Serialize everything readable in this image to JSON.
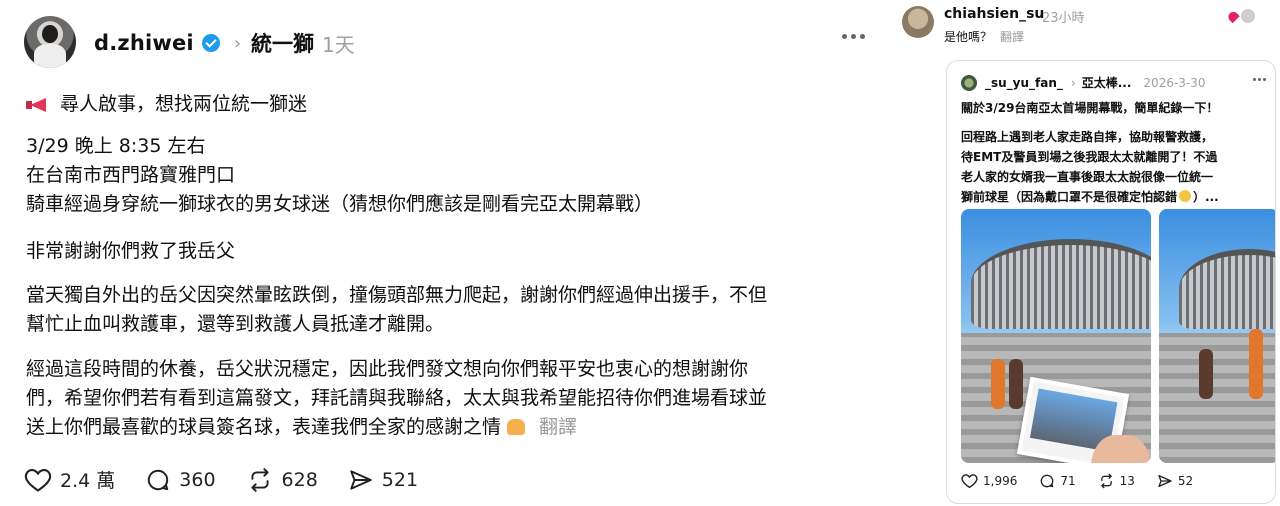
{
  "post": {
    "username": "d.zhiwei",
    "topic": "統一獅",
    "time": "1天",
    "lines": {
      "headline": "尋人啟事，想找兩位統一獅迷",
      "l1": "3/29 晚上 8:35 左右",
      "l2": "在台南市西門路寶雅門口",
      "l3": "騎車經過身穿統一獅球衣的男女球迷（猜想你們應該是剛看完亞太開幕戰）",
      "l4": "非常謝謝你們救了我岳父",
      "l5a": "當天獨自外出的岳父因突然暈眩跌倒，撞傷頭部無力爬起，謝謝你們經過伸出援手，不但",
      "l5b": "幫忙止血叫救護車，還等到救護人員抵達才離開。",
      "l6a": "經過這段時間的休養，岳父狀況穩定，因此我們發文想向你們報平安也衷心的想謝謝你",
      "l6b": "們，希望你們若有看到這篇發文，拜託請與我聯絡，太太與我希望能招待你們進場看球並",
      "l6c": "送上你們最喜歡的球員簽名球，表達我們全家的感謝之情"
    },
    "translate": "翻譯",
    "stats": {
      "likes": "2.4 萬",
      "comments": "360",
      "reposts": "628",
      "shares": "521"
    }
  },
  "reply": {
    "username": "chiahsien_su",
    "time": "23小時",
    "text": "是他嗎？",
    "translate": "翻譯",
    "quoted": {
      "username": "_su_yu_fan_",
      "topic": "亞太棒...",
      "date": "2026-3-30",
      "title": "關於3/29台南亞太首場開幕戰，簡單紀錄一下！",
      "b1": "回程路上遇到老人家走路自摔，協助報警救護，",
      "b2": "待EMT及警員到場之後我跟太太就離開了！不過",
      "b3": "老人家的女婿我一直事後跟太太說很像一位統一",
      "b4a": "獅前球星（因為戴口罩不是很確定怕認錯",
      "b4b": "）...",
      "stats": {
        "likes": "1,996",
        "comments": "71",
        "reposts": "13",
        "shares": "52"
      }
    }
  },
  "icons": {
    "verified": "verified-badge-icon",
    "megaphone": "megaphone-icon",
    "pray": "folded-hands-emoji-icon",
    "smile": "smiling-face-emoji-icon"
  },
  "colors": {
    "verified": "#1d9bf0",
    "muted": "#a0a0a0",
    "text": "#101010",
    "heart_reaction": "#e0245e"
  }
}
